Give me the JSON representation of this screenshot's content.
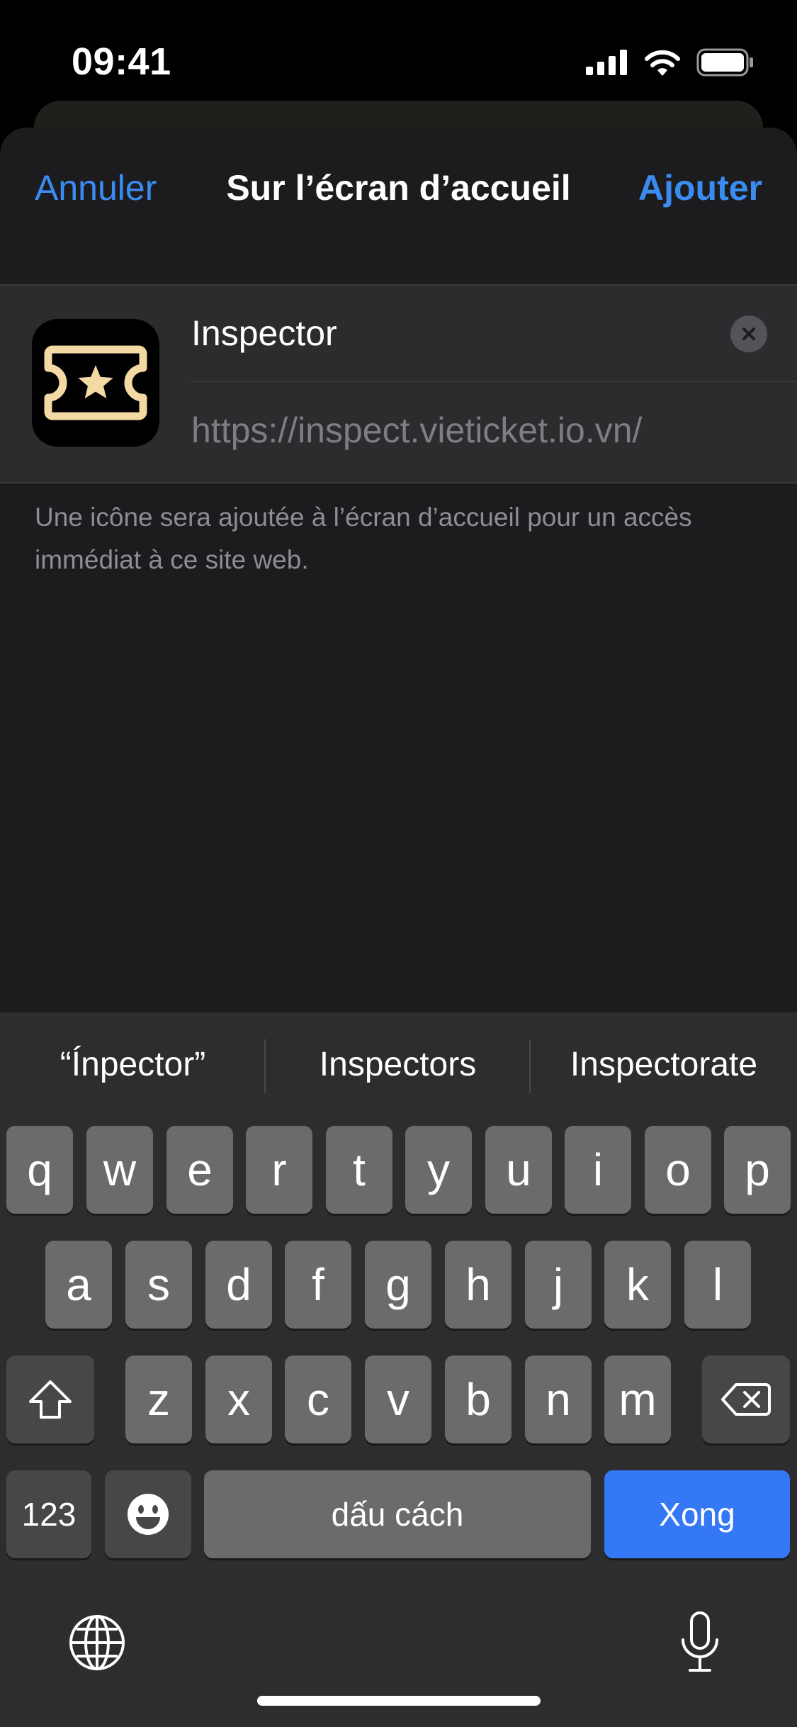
{
  "status_bar": {
    "time": "09:41"
  },
  "sheet": {
    "cancel_label": "Annuler",
    "title": "Sur l’écran d’accueil",
    "add_label": "Ajouter",
    "name_value": "Inspector",
    "url": "https://inspect.vieticket.io.vn/",
    "footnote": "Une icône sera ajoutée à l’écran d’accueil pour un accès immédiat à ce site web."
  },
  "keyboard": {
    "suggestions": [
      "“Ínpector”",
      "Inspectors",
      "Inspectorate"
    ],
    "row1": [
      "q",
      "w",
      "e",
      "r",
      "t",
      "y",
      "u",
      "i",
      "o",
      "p"
    ],
    "row2": [
      "a",
      "s",
      "d",
      "f",
      "g",
      "h",
      "j",
      "k",
      "l"
    ],
    "row3": [
      "z",
      "x",
      "c",
      "v",
      "b",
      "n",
      "m"
    ],
    "numbers_label": "123",
    "space_label": "dấu cách",
    "done_label": "Xong"
  },
  "colors": {
    "accent": "#3b8cf2",
    "done_key": "#3478f6",
    "icon_gold": "#f3d9a4"
  },
  "icons": [
    "signal-icon",
    "wifi-icon",
    "battery-icon",
    "ticket-star-icon",
    "clear-icon",
    "shift-icon",
    "delete-icon",
    "emoji-icon",
    "globe-icon",
    "microphone-icon"
  ]
}
